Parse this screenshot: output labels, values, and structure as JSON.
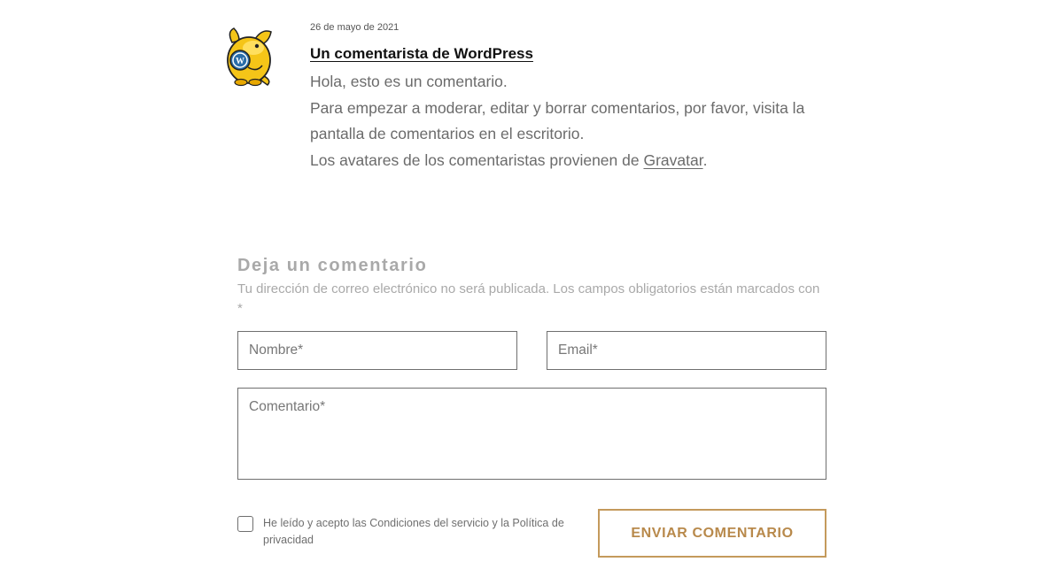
{
  "comment": {
    "date": "26 de mayo de 2021",
    "author": "Un comentarista de WordPress",
    "lines": [
      "Hola, esto es un comentario.",
      "Para empezar a moderar, editar y borrar comentarios, por favor, visita la pantalla de comentarios en el escritorio.",
      "Los avatares de los comentaristas provienen de "
    ],
    "gravatar_link": "Gravatar",
    "after_link": "."
  },
  "reply_form": {
    "title": "Deja un comentario",
    "notes": "Tu dirección de correo electrónico no será publicada. Los campos obligatorios están marcados con *",
    "name_placeholder": "Nombre*",
    "email_placeholder": "Email*",
    "comment_placeholder": "Comentario*",
    "consent_label": "He leído y acepto las Condiciones del servicio y la Política de privacidad",
    "consent_checked": false,
    "submit_label": "ENVIAR COMENTARIO"
  },
  "colors": {
    "accent": "#c49a5c",
    "muted_text": "#a9a9a9",
    "body_text": "#6b6b6b",
    "avatar_yellow": "#f5c518",
    "avatar_blue": "#2b6da8"
  },
  "icons": {
    "avatar": "wapuu-avatar-icon"
  }
}
